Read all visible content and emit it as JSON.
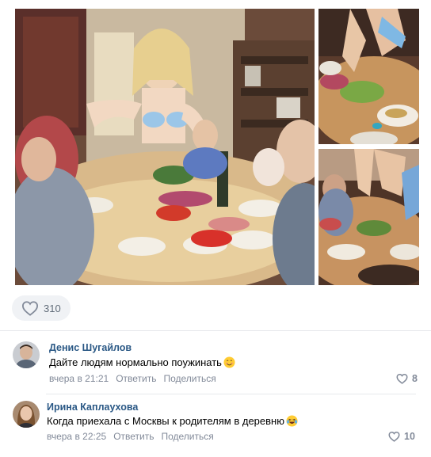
{
  "post": {
    "photos": [
      {
        "alt": "family-dinner-photo"
      },
      {
        "alt": "table-closeup-photo"
      },
      {
        "alt": "family-dinner-side-photo"
      }
    ],
    "likes": "310",
    "like_icon": "heart-outline-icon"
  },
  "comments": [
    {
      "author": "Денис Шугайлов",
      "text": "Дайте людям нормально поужинать",
      "emoji": "smiling-face-emoji",
      "time": "вчера в 21:21",
      "reply_label": "Ответить",
      "share_label": "Поделиться",
      "likes": "8"
    },
    {
      "author": "Ирина Каплаухова",
      "text": "Когда приехала с Москвы к родителям в деревню",
      "emoji": "laughing-tears-emoji",
      "time": "вчера в 22:25",
      "reply_label": "Ответить",
      "share_label": "Поделиться",
      "likes": "10"
    }
  ],
  "colors": {
    "link": "#2a5885",
    "muted": "#828a99",
    "pill_bg": "#f0f2f5",
    "divider": "#e7e8ec"
  }
}
